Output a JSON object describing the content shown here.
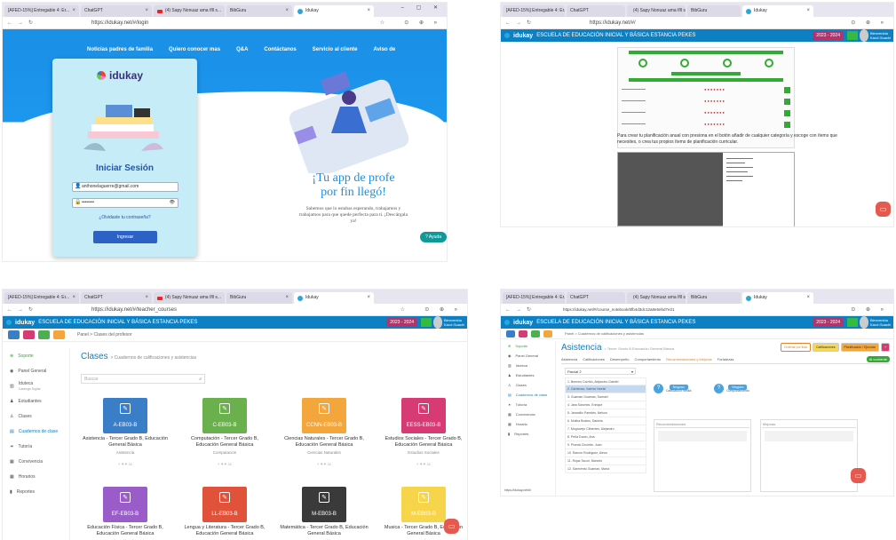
{
  "browser": {
    "tabs": [
      "[AFED-15%] Entregable 4: Er...",
      "ChatGPT",
      "(4) Sapy Nonuaz ama Ifll s...",
      "BibGuru",
      "Idukay"
    ],
    "yt_sub": "REPRODUCIENDO",
    "urls": {
      "p1": "https://idukay.net/#/login",
      "p2": "https://idukay.net/#/",
      "p3": "https://idukay.net/#/teacher_courses",
      "p4": "https://idukay.net/#/course_notebook/6fb4d3dc12a8e5ebd7e21"
    }
  },
  "login": {
    "brand": "idukay",
    "nav": [
      "Noticias padres de familia",
      "Quiero conocer mas",
      "Q&A",
      "Contáctanos",
      "Servicio al cliente",
      "Aviso de"
    ],
    "title": "Iniciar Sesión",
    "email": "anthonelaguerre@gmail.com",
    "password": "••••••••",
    "forgot": "¿Olvidaste tu contraseña?",
    "submit": "Ingresar",
    "tagline1": "¡Tu app de profe",
    "tagline2": "por fin llegó!",
    "subtagline": "Sabemos que lo estabas esperando, trabajamos y trabajamos para que quede perfecta para ti. ¡Descárgala ya!",
    "help": "Ayuda"
  },
  "header": {
    "brand": "idukay",
    "school": "ESCUELA DE EDUCACIÓN INICIAL Y BÁSICA ESTANCIA PEKES",
    "year": "2023 - 2024",
    "user": "Bienvenida Karol Guachi"
  },
  "p2": {
    "paragraph": "Para crear tu planificación anual con presiona en el botón añadir de cualquier categoría y escoge con ítems que necesites, o crea tus propios ítems de planificación curricular."
  },
  "p3": {
    "breadcrumb": "Panel > Clases del profesor",
    "title": "Clases",
    "subtitle": "> Cuadernos de calificaciones y asistencias",
    "search_placeholder": "Buscar",
    "sidebar": [
      "Soporte",
      "Panel General",
      "Iduteca",
      "Estudiantes",
      "Clases",
      "Cuadernos de clase",
      "Tutoría",
      "Convivencia",
      "Horarios",
      "Reportes"
    ],
    "iduteca_sub": "Catálogo Digital",
    "courses": [
      {
        "code": "A-EB03-B",
        "title": "Asistencia - Tercer Grado B, Educación General Básica",
        "subject": "Asistencia",
        "color": "#3b7ec8"
      },
      {
        "code": "C-EB03-B",
        "title": "Computación - Tercer Grado B, Educación General Básica",
        "subject": "Computación",
        "color": "#6ab04c"
      },
      {
        "code": "CCNN-EB03-B",
        "title": "Ciencias Naturales - Tercer Grado B, Educación General Básica",
        "subject": "Ciencias Naturales",
        "color": "#f3a63c"
      },
      {
        "code": "EESS-EB03-B",
        "title": "Estudios Sociales - Tercer Grado B, Educación General Básica",
        "subject": "Estudios Sociales",
        "color": "#d63b73"
      },
      {
        "code": "EF-EB03-B",
        "title": "Educación Física - Tercer Grado B, Educación General Básica",
        "subject": "Educación Física",
        "color": "#9a5cc8"
      },
      {
        "code": "LL-EB03-B",
        "title": "Lengua y Literatura - Tercer Grado B, Educación General Básica",
        "subject": "Lengua y Literatura",
        "color": "#e0533a"
      },
      {
        "code": "M-EB03-B",
        "title": "Matemática - Tercer Grado B, Educación General Básica",
        "subject": "Matemática",
        "color": "#3a3a3a"
      },
      {
        "code": "M-EB03-B",
        "title": "Musica - Tercer Grado B, Educación General Básica",
        "subject": "Musica",
        "color": "#f7d54a"
      }
    ],
    "card_footer": "+ ⚘⚘ 11"
  },
  "p4": {
    "breadcrumb": "Panel > Cuadernos de calificaciones y asistencias",
    "title": "Asistencia",
    "subtitle": "> Tercer Grado B Educación General Básica",
    "buttons": [
      "Ordenar por lista",
      "Calificaciones",
      "Planificación / Ejecutar"
    ],
    "tabs": [
      "Asistencia",
      "Calificaciones",
      "Desempeño",
      "Comportamiento",
      "Recomendaciones y Mejoras",
      "Fortalezas"
    ],
    "badge": "Al corriente",
    "period": "Parcial 2",
    "students": [
      "1. Bermeo Carrión, Alejandro Gabriel",
      "2. Cárdenas, Valeria Yaretzi",
      "3. Guaman Guaman, Samuel",
      "4. Jara Sanchez, Enrique",
      "5. Jaramillo Paredes, Nelson",
      "6. Molina Bustos, Daniela",
      "7. Mogrovejo Cifuentes, Alejandro",
      "8. Peña Duran, Ana",
      "9. Pineda Chumbe, Juan",
      "10. Ramón Rodriguez, Alexa",
      "11. Rojas Tacuri, Marcelo",
      "12. Sarmiento Guaman, María"
    ],
    "badge1": "Calificación media",
    "badge2": "Comportamiento",
    "recomendaciones": "Recomendaciones",
    "mejoras": "Mejoras",
    "status": "https://idukay.net/#/",
    "sidebar": [
      "Soporte",
      "Panel General",
      "Iduteca",
      "Estudiantes",
      "Clases",
      "Cuadernos de clase",
      "Tutoría",
      "Convivencia",
      "Horario",
      "Reportes"
    ]
  }
}
